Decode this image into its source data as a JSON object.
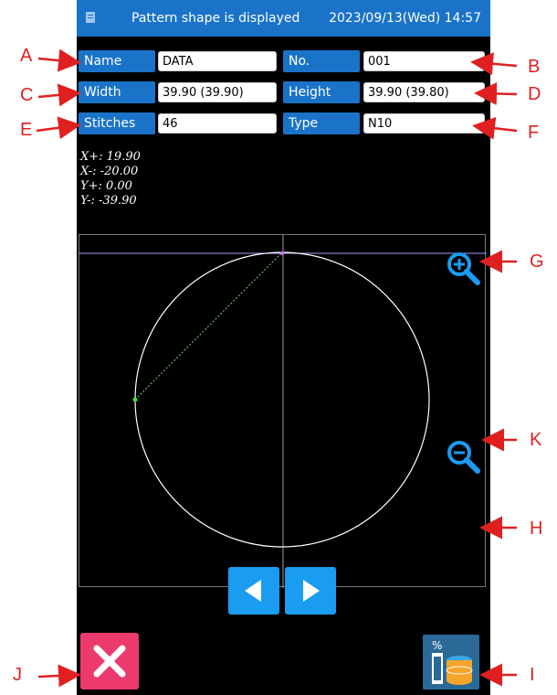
{
  "header": {
    "title": "Pattern shape is displayed",
    "datetime": "2023/09/13(Wed) 14:57"
  },
  "fields": {
    "name": {
      "label": "Name",
      "value": "DATA"
    },
    "no": {
      "label": "No.",
      "value": "001"
    },
    "width": {
      "label": "Width",
      "value": "39.90 (39.90)"
    },
    "height": {
      "label": "Height",
      "value": "39.90 (39.80)"
    },
    "stitches": {
      "label": "Stitches",
      "value": "46"
    },
    "type": {
      "label": "Type",
      "value": "N10"
    }
  },
  "coordinates": {
    "x_plus": "X+: 19.90",
    "x_minus": "X-: -20.00",
    "y_plus": "Y+: 0.00",
    "y_minus": "Y-: -39.90"
  },
  "callouts": {
    "A": "A",
    "B": "B",
    "C": "C",
    "D": "D",
    "E": "E",
    "F": "F",
    "G": "G",
    "H": "H",
    "I": "I",
    "J": "J",
    "K": "K"
  },
  "icons": {
    "zoom_in": "zoom-in-icon",
    "zoom_out": "zoom-out-icon",
    "prev": "left-arrow-icon",
    "next": "right-arrow-icon",
    "close": "close-icon",
    "data": "database-icon"
  },
  "colors": {
    "accent": "#1a73c8",
    "nav": "#1a9cf0",
    "close": "#ec3a6e",
    "callout": "#e02020"
  }
}
